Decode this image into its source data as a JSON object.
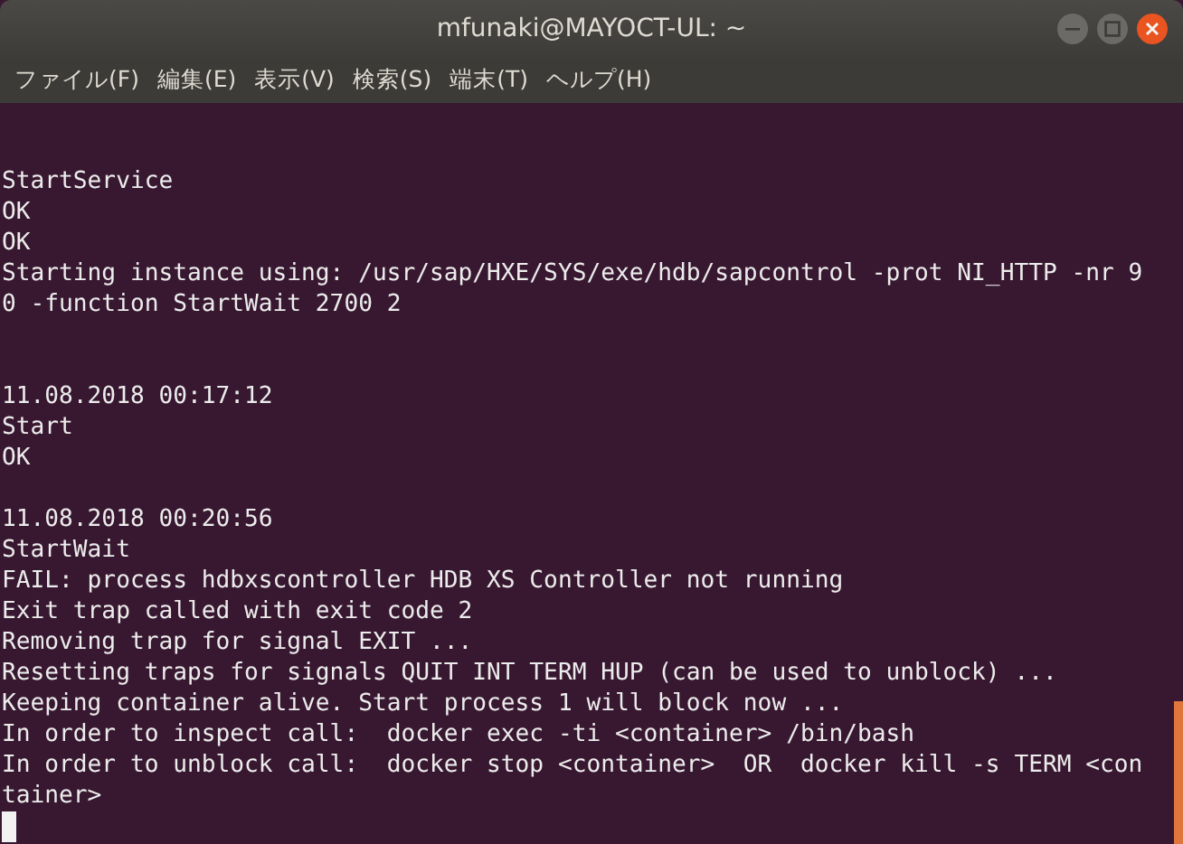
{
  "window": {
    "title": "mfunaki@MAYOCT-UL: ~"
  },
  "menu": [
    {
      "label": "ファイル(F)"
    },
    {
      "label": "編集(E)"
    },
    {
      "label": "表示(V)"
    },
    {
      "label": "検索(S)"
    },
    {
      "label": "端末(T)"
    },
    {
      "label": "ヘルプ(H)"
    }
  ],
  "terminal": {
    "lines": [
      {
        "kind": "blank"
      },
      {
        "kind": "blank"
      },
      {
        "kind": "text",
        "text": "StartService"
      },
      {
        "kind": "text",
        "text": "OK"
      },
      {
        "kind": "text",
        "text": "OK"
      },
      {
        "kind": "text",
        "text": "Starting instance using: /usr/sap/HXE/SYS/exe/hdb/sapcontrol -prot NI_HTTP -nr 9"
      },
      {
        "kind": "text",
        "text": "0 -function StartWait 2700 2"
      },
      {
        "kind": "blank"
      },
      {
        "kind": "blank"
      },
      {
        "kind": "text",
        "text": "11.08.2018 00:17:12"
      },
      {
        "kind": "text",
        "text": "Start"
      },
      {
        "kind": "text",
        "text": "OK"
      },
      {
        "kind": "blank"
      },
      {
        "kind": "text",
        "text": "11.08.2018 00:20:56"
      },
      {
        "kind": "text",
        "text": "StartWait"
      },
      {
        "kind": "text",
        "text": "FAIL: process hdbxscontroller HDB XS Controller not running"
      },
      {
        "kind": "text",
        "text": "Exit trap called with exit code 2"
      },
      {
        "kind": "text",
        "text": "Removing trap for signal EXIT ..."
      },
      {
        "kind": "text",
        "text": "Resetting traps for signals QUIT INT TERM HUP (can be used to unblock) ..."
      },
      {
        "kind": "text",
        "text": "Keeping container alive. Start process 1 will block now ..."
      },
      {
        "kind": "text",
        "text": "In order to inspect call:  docker exec -ti <container> /bin/bash"
      },
      {
        "kind": "text",
        "text": "In order to unblock call:  docker stop <container>  OR  docker kill -s TERM <con"
      },
      {
        "kind": "text",
        "text": "tainer>"
      },
      {
        "kind": "cursor"
      }
    ]
  }
}
